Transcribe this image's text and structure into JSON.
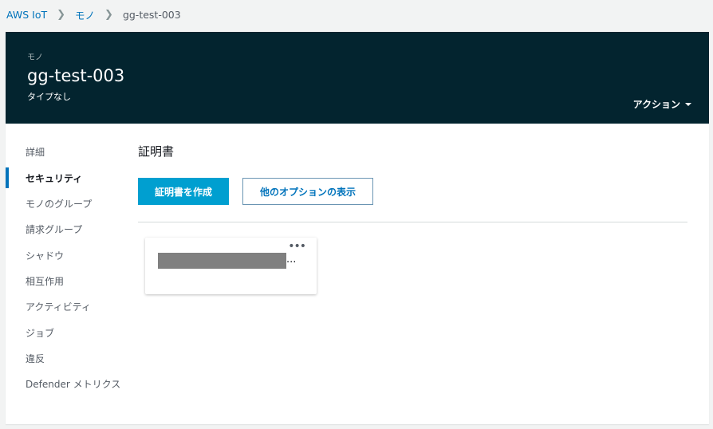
{
  "breadcrumb": {
    "root": "AWS IoT",
    "parent": "モノ",
    "current": "gg-test-003"
  },
  "header": {
    "kind": "モノ",
    "title": "gg-test-003",
    "subtitle": "タイプなし",
    "action_label": "アクション"
  },
  "sidenav": {
    "items": [
      {
        "label": "詳細"
      },
      {
        "label": "セキュリティ",
        "active": true
      },
      {
        "label": "モノのグループ"
      },
      {
        "label": "請求グループ"
      },
      {
        "label": "シャドウ"
      },
      {
        "label": "相互作用"
      },
      {
        "label": "アクティビティ"
      },
      {
        "label": "ジョブ"
      },
      {
        "label": "違反"
      },
      {
        "label": "Defender メトリクス"
      }
    ]
  },
  "main": {
    "section_title": "証明書",
    "create_button": "証明書を作成",
    "options_button": "他のオプションの表示",
    "card": {
      "menu": "•••",
      "ellipsis": "..."
    }
  },
  "colors": {
    "header_bg": "#03242f",
    "primary": "#009fd0",
    "link": "#0073bb"
  }
}
